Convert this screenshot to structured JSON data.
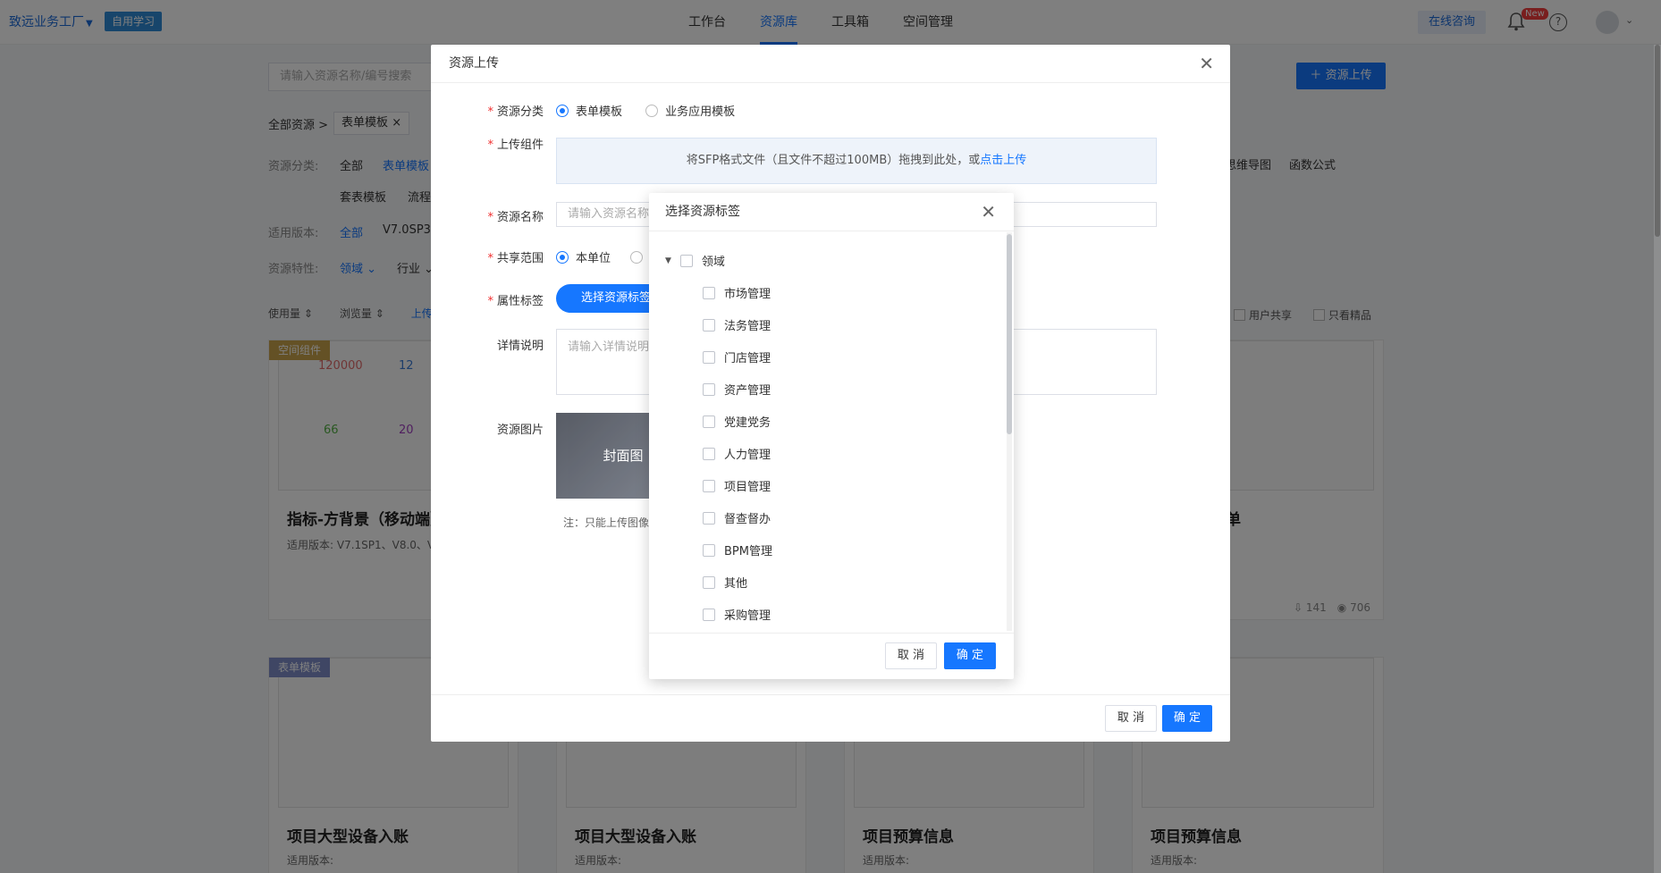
{
  "header": {
    "brand": "致远业务工厂",
    "study_badge": "自用学习",
    "nav": [
      "工作台",
      "资源库",
      "工具箱",
      "空间管理"
    ],
    "active_nav": "资源库",
    "consult": "在线咨询",
    "new_tag": "New",
    "help_glyph": "?"
  },
  "toolbar": {
    "search_placeholder": "请输入资源名称/编号搜索",
    "upload_button": "资源上传"
  },
  "breadcrumb": {
    "root": "全部资源 >",
    "chip": "表单模板"
  },
  "filters": {
    "category_label": "资源分类:",
    "category_values": [
      "全部",
      "表单模板",
      "套表模板",
      "流程"
    ],
    "category_right": [
      "思维导图",
      "函数公式"
    ],
    "version_label": "适用版本:",
    "version_values": [
      "全部",
      "V7.0SP3"
    ],
    "feature_label": "资源特性:",
    "feature_values": [
      "领域",
      "行业"
    ]
  },
  "sort": [
    "使用量",
    "浏览量",
    "上传"
  ],
  "right_checks": [
    "用户共享",
    "只看精品"
  ],
  "cards": [
    {
      "title": "指标-方背景（移动端）",
      "meta": "适用版本: V7.1SP1、V8.0、V",
      "tag": "空间组件"
    },
    {
      "title": "项目大型设备入账",
      "meta": "适用版本:",
      "tag": "表单模板"
    },
    {
      "title": "项目大型设备入账",
      "meta": "适用版本:"
    },
    {
      "title": "项目预算信息",
      "meta": "适用版本:"
    },
    {
      "title": "项目预算信息",
      "meta": "适用版本:"
    }
  ],
  "card_right_top": {
    "title_tail": "单",
    "likes": "141",
    "views": "706"
  },
  "thumb_numbers": {
    "a": "120000",
    "b": "12",
    "c": "66",
    "d": "20"
  },
  "upload_dialog": {
    "title": "资源上传",
    "category_label": "资源分类",
    "category_options": [
      "表单模板",
      "业务应用模板"
    ],
    "component_label": "上传组件",
    "dropzone_text": "将SFP格式文件（且文件不超过100MB）拖拽到此处，或",
    "dropzone_link": "点击上传",
    "name_label": "资源名称",
    "name_placeholder": "请输入资源名称",
    "scope_label": "共享范围",
    "scope_option": "本单位",
    "tag_label": "属性标签",
    "tag_button": "选择资源标签",
    "detail_label": "详情说明",
    "detail_placeholder": "请输入详情说明",
    "image_label": "资源图片",
    "cover_text": "封面图",
    "note": "注：只能上传图像",
    "cancel": "取 消",
    "confirm": "确 定"
  },
  "tag_dialog": {
    "title": "选择资源标签",
    "root": "领域",
    "items": [
      "市场管理",
      "法务管理",
      "门店管理",
      "资产管理",
      "党建党务",
      "人力管理",
      "项目管理",
      "督查督办",
      "BPM管理",
      "其他",
      "采购管理"
    ],
    "cancel": "取 消",
    "confirm": "确 定"
  }
}
